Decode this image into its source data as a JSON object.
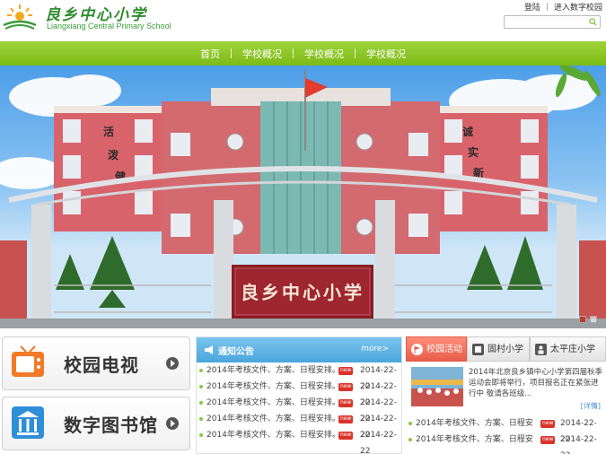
{
  "header": {
    "school_name_cn": "良乡中心小学",
    "school_name_en": "Liangxiang Central Primary School",
    "login": "登陆",
    "digital_campus": "进入数字校园",
    "search_placeholder": ""
  },
  "nav": {
    "items": [
      "首页",
      "学校概况",
      "学校概况",
      "学校概况"
    ]
  },
  "banner": {
    "gate_sign": "良乡中心小学",
    "slogan_left": [
      "活",
      "泼",
      "健"
    ],
    "slogan_right": [
      "诚",
      "实",
      "新"
    ]
  },
  "quick_links": [
    {
      "label": "校园电视",
      "icon": "tv-icon"
    },
    {
      "label": "数字图书馆",
      "icon": "library-icon"
    }
  ],
  "notice": {
    "title": "通知公告",
    "more": "more>",
    "items": [
      {
        "text": "2014年考核文件、方案、日程安排。",
        "date": "2014-22-22"
      },
      {
        "text": "2014年考核文件、方案、日程安排。",
        "date": "2014-22-22"
      },
      {
        "text": "2014年考核文件、方案、日程安排。",
        "date": "2014-22-22"
      },
      {
        "text": "2014年考核文件、方案、日程安排。",
        "date": "2014-22-22"
      },
      {
        "text": "2014年考核文件、方案、日程安排。",
        "date": "2014-22-22"
      }
    ],
    "new_badge": "new"
  },
  "activity": {
    "tabs": [
      "校园活动",
      "固村小学",
      "太平庄小学"
    ],
    "feature_text": "2014年北京良乡镇中心小学第四届秋季运动会即将举行，项目报名正在紧张进行中 敬请各班级...",
    "detail": "[详情]",
    "items": [
      {
        "text": "2014年考核文件、方案、日程安",
        "date": "2014-22-22"
      },
      {
        "text": "2014年考核文件、方案、日程安",
        "date": "2014-22-22"
      }
    ]
  },
  "colors": {
    "nav_green": "#8cc63f",
    "notice_blue": "#4aa6dc",
    "activity_red": "#e85b4a",
    "brand_green": "#2e8b2e"
  }
}
